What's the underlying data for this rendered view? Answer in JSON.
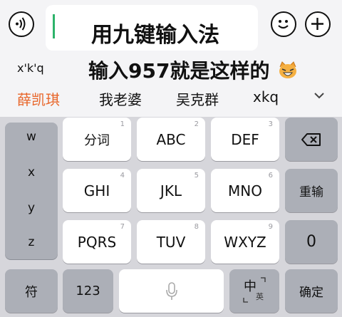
{
  "caption": {
    "line1": "用九键输入法",
    "line2": "输入957就是这样的"
  },
  "icons": {
    "voice_left": "sound-wave-icon",
    "emoji": "smiley-icon",
    "add": "plus-icon",
    "delete": "backspace-icon",
    "mic": "microphone-icon",
    "collapse": "chevron-down-icon",
    "sticker": "laughing-cat-emoji-icon"
  },
  "candidates": {
    "pinyin": "x'k'q",
    "items": [
      "薛凯琪",
      "我老婆",
      "吴克群",
      "xkq"
    ],
    "highlight_color": "#e8662a"
  },
  "keyboard": {
    "side_letters": [
      "w",
      "x",
      "y",
      "z"
    ],
    "keys": [
      {
        "label": "分词",
        "num": "1"
      },
      {
        "label": "ABC",
        "num": "2"
      },
      {
        "label": "DEF",
        "num": "3"
      },
      {
        "label": "GHI",
        "num": "4"
      },
      {
        "label": "JKL",
        "num": "5"
      },
      {
        "label": "MNO",
        "num": "6"
      },
      {
        "label": "PQRS",
        "num": "7"
      },
      {
        "label": "TUV",
        "num": "8"
      },
      {
        "label": "WXYZ",
        "num": "9"
      }
    ],
    "reinput": "重输",
    "zero": "0",
    "symbol": "符",
    "numeric": "123",
    "lang_main": "中",
    "lang_sub": "英",
    "confirm": "确定"
  }
}
